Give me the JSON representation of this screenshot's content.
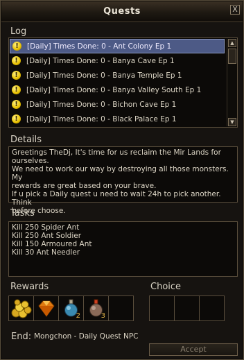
{
  "window": {
    "title": "Quests",
    "close_label": "X"
  },
  "log": {
    "label": "Log",
    "items": [
      {
        "label": "[Daily] Times Done: 0 - Ant Colony Ep 1",
        "selected": true
      },
      {
        "label": "[Daily] Times Done: 0 - Banya Cave Ep 1",
        "selected": false
      },
      {
        "label": "[Daily] Times Done: 0 - Banya Temple Ep 1",
        "selected": false
      },
      {
        "label": "[Daily] Times Done: 0 - Banya Valley South Ep 1",
        "selected": false
      },
      {
        "label": "[Daily] Times Done: 0 - Bichon Cave Ep 1",
        "selected": false
      },
      {
        "label": "[Daily] Times Done: 0 - Black Palace Ep 1",
        "selected": false
      }
    ],
    "item_icon": "exclamation-icon"
  },
  "details": {
    "label": "Details",
    "text": "Greetings TheDj, It's time for us reclaim the Mir Lands for ourselves.\nWe need to work our way by destroying all those monsters. My\nrewards are great based on your brave.\nIf u pick a Daily quest u need to wait 24h to pick another. Think\nbefore choose."
  },
  "tasks": {
    "label": "Tasks",
    "items": [
      "Kill 250 Spider Ant",
      "Kill 250 Ant Soldier",
      "Kill 150 Armoured Ant",
      "Kill 30 Ant Needler"
    ]
  },
  "rewards": {
    "label": "Rewards",
    "slots": [
      {
        "icon": "gold-coins-icon",
        "qty": ""
      },
      {
        "icon": "gem-icon",
        "qty": ""
      },
      {
        "icon": "blue-potion-icon",
        "qty": "2"
      },
      {
        "icon": "brown-potion-icon",
        "qty": "3"
      },
      {
        "icon": "",
        "qty": ""
      }
    ]
  },
  "choice": {
    "label": "Choice"
  },
  "end": {
    "label": "End:",
    "value": "Mongchon - Daily Quest NPC"
  },
  "accept_label": "Accept"
}
